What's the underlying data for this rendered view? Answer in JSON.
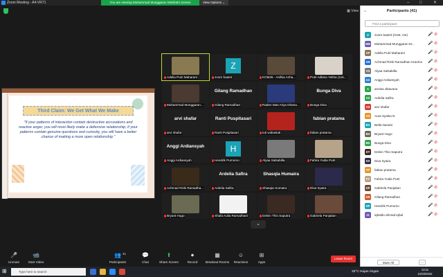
{
  "window": {
    "title": "Zoom Meeting - A4-VR71",
    "min_glyph": "–",
    "max_glyph": "□",
    "close_glyph": "✕"
  },
  "banner": {
    "viewing": "You are viewing Muhammad Munggaran Meldrat's screen",
    "view_options": "View Options ⌄"
  },
  "view_button": "▦ View",
  "shared_slide": {
    "title": "Third Claim: We Get What We Make",
    "body": "\"If your patterns of interaction contain destructive accusations and reactive anger, you will most likely make a defensive relationship; if your patterns contain genuine questions and curiosity, you will have a better chance of making a more open relationship.\""
  },
  "gallery": {
    "down_glyph": "⌄",
    "tiles": [
      {
        "kind": "video",
        "name": "Adelia Putri Maharani",
        "color": "#8a7a52",
        "active": true
      },
      {
        "kind": "avatar",
        "name": "zoom baa04",
        "letter": "Z",
        "color": "#1aa4b5"
      },
      {
        "kind": "video",
        "name": "KOM25 - Ardhia Azha...",
        "color": "#5a4a3a"
      },
      {
        "kind": "video",
        "name": "Putri Adlaria Yekha (116...",
        "color": "#d8d2c8"
      },
      {
        "kind": "video",
        "name": "Muhammad Munggaran...",
        "color": "#4a3a32"
      },
      {
        "kind": "text",
        "name": "Gilang Ramadhan",
        "big": "Gilang Ramadhan"
      },
      {
        "kind": "video",
        "name": "Raden Mas Ariya Dhana...",
        "color": "#2a3a7a"
      },
      {
        "kind": "text",
        "name": "Bunga Diva",
        "big": "Bunga Diva"
      },
      {
        "kind": "text",
        "name": "arvi shafar",
        "big": "arvi shafar"
      },
      {
        "kind": "text",
        "name": "Ranti Puspitasari",
        "big": "Ranti Puspitasari"
      },
      {
        "kind": "video",
        "name": "tuti widiastuti",
        "color": "#b5231f"
      },
      {
        "kind": "text",
        "name": "fabian pratama",
        "big": "fabian pratama"
      },
      {
        "kind": "text",
        "name": "Anggi Ardiansyah",
        "big": "Anggi Ardiansyah"
      },
      {
        "kind": "avatar",
        "name": "Hendrik Purnomo",
        "letter": "H",
        "color": "#1aa4b5"
      },
      {
        "kind": "video",
        "name": "Alyaa Salsabilla",
        "color": "#7a7a7a"
      },
      {
        "kind": "video",
        "name": "Fahira Yudia Putri",
        "color": "#b6a48a"
      },
      {
        "kind": "video",
        "name": "Achmad Rizki Ramadha...",
        "color": "#3a2a1a"
      },
      {
        "kind": "text",
        "name": "Ardelia Safira",
        "big": "Ardelia Safira"
      },
      {
        "kind": "text",
        "name": "Shasqia Humaira",
        "big": "Shasqia Humaira"
      },
      {
        "kind": "video",
        "name": "Diva Syaira",
        "color": "#2c2a4a"
      },
      {
        "kind": "video",
        "name": "Bryant Hugo",
        "color": "#6b6a52"
      },
      {
        "kind": "video",
        "name": "Shafa Aulia Ramadhani",
        "color": "#f2f2f2"
      },
      {
        "kind": "video",
        "name": "Delvin Thio Saputra",
        "color": "#3a2a22"
      },
      {
        "kind": "video",
        "name": "Gabriela Panjaitan",
        "color": "#6a4a3a"
      }
    ]
  },
  "panel": {
    "title": "Participants (41)",
    "minimize_glyph": "⌄",
    "search_placeholder": "Find a participant",
    "mic_glyph": "🎤",
    "cam_glyph": "⊘",
    "mute_all": "Mute All",
    "more": "...",
    "participants": [
      {
        "initials": "Z",
        "name": "zoom baa04 (Host, me)",
        "color": "#1aa4b5"
      },
      {
        "initials": "MM",
        "name": "Muhammad Munggaran M...",
        "color": "#6d5bb5"
      },
      {
        "initials": "AP",
        "name": "Adelia Putri Maharani",
        "color": "#8a7a52"
      },
      {
        "initials": "AR",
        "name": "Achmad Rizki Ramadhan Hutomo",
        "color": "#2a6fd6"
      },
      {
        "initials": "AS",
        "name": "Alyaa Salsabilla",
        "color": "#7a7a7a"
      },
      {
        "initials": "AA",
        "name": "Anggi Ardiansyah",
        "color": "#2f7fd0"
      },
      {
        "initials": "A",
        "name": "annisa olitavana",
        "color": "#2aa54a"
      },
      {
        "initials": "AS",
        "name": "Ardelia Safira",
        "color": "#2aa54a"
      },
      {
        "initials": "AS",
        "name": "arvi shafar",
        "color": "#d63a3a"
      },
      {
        "initials": "AS",
        "name": "Aura Syalsa N",
        "color": "#e6952b"
      },
      {
        "initials": "BA",
        "name": "Bella Nuraini",
        "color": "#1aa4b5"
      },
      {
        "initials": "BH",
        "name": "Bryant Hugo",
        "color": "#6b6a52"
      },
      {
        "initials": "BD",
        "name": "Bunga Diva",
        "color": "#2aa54a"
      },
      {
        "initials": "DT",
        "name": "Delvin Thio Saputra",
        "color": "#3a2a22"
      },
      {
        "initials": "DS",
        "name": "Diva Syaira",
        "color": "#2c2a4a"
      },
      {
        "initials": "FP",
        "name": "fabian pratama",
        "color": "#e6952b"
      },
      {
        "initials": "FY",
        "name": "Fahira Yudia Putri",
        "color": "#b6a48a"
      },
      {
        "initials": "GP",
        "name": "Gabriela Panjaitan",
        "color": "#6a4a3a"
      },
      {
        "initials": "GR",
        "name": "Gilang Ramadhan",
        "color": "#d05a2a"
      },
      {
        "initials": "HP",
        "name": "Hendrik Purnomo",
        "color": "#1aa4b5"
      },
      {
        "initials": "IA",
        "name": "iqbaldo ahmad iqbal",
        "color": "#6d5bb5"
      }
    ]
  },
  "toolbar": {
    "unmute": "Unmute",
    "unmute_icon": "🎤",
    "start_video": "Start Video",
    "video_icon": "📹",
    "participants": "Participants",
    "participants_count": "41",
    "participants_icon": "👥",
    "chat": "Chat",
    "chat_icon": "💬",
    "share_screen": "Share Screen",
    "share_icon": "⬆",
    "record": "Record",
    "record_icon": "⏺",
    "breakout": "Breakout Rooms",
    "breakout_icon": "▦",
    "reactions": "Reactions",
    "reactions_icon": "☺",
    "apps": "Apps",
    "apps_icon": "⊞",
    "leave": "Leave Room"
  },
  "taskbar": {
    "search_placeholder": "Type here to search",
    "start_glyph": "⊞",
    "weather": "33°C Hujan ringan",
    "time": "13:11",
    "date": "21/03/2022"
  }
}
